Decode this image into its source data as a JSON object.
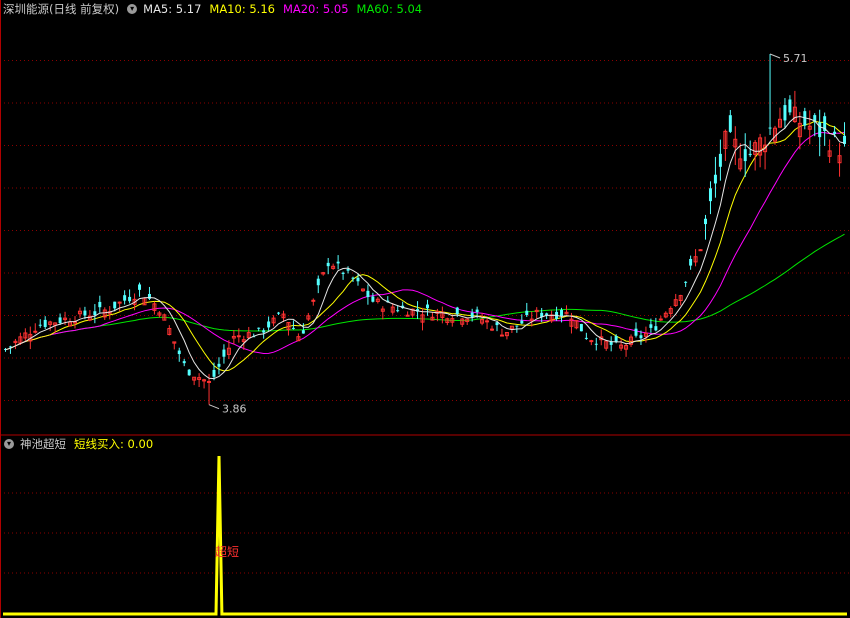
{
  "header": {
    "title": "深圳能源(日线 前复权)",
    "ma5_label": "MA5: 5.17",
    "ma10_label": "MA10: 5.16",
    "ma20_label": "MA20: 5.05",
    "ma60_label": "MA60: 5.04"
  },
  "indicator_header": {
    "title": "神池超短",
    "value_label": "短线买入: 0.00"
  },
  "colors": {
    "background": "#000000",
    "up": "#ff3232",
    "down": "#54ffff",
    "ma5": "#e6e6e6",
    "ma10": "#ffff00",
    "ma20": "#ff00ff",
    "ma60": "#00e600",
    "grid": "#8b0000",
    "title": "#c8c8c8",
    "signal": "#ffff00"
  },
  "chart_data": [
    {
      "type": "candlestick",
      "symbol": "深圳能源",
      "high_annotation": {
        "label": "5.71",
        "value": 5.71
      },
      "low_annotation": {
        "label": "3.86",
        "value": 3.86
      },
      "ylim": [
        3.7,
        5.9
      ],
      "legend": [
        "MA5: 5.17",
        "MA10: 5.16",
        "MA20: 5.05",
        "MA60: 5.04"
      ]
    },
    {
      "type": "line",
      "name": "短线买入",
      "label": "超短",
      "signal_value": 1,
      "baseline": 0
    }
  ]
}
